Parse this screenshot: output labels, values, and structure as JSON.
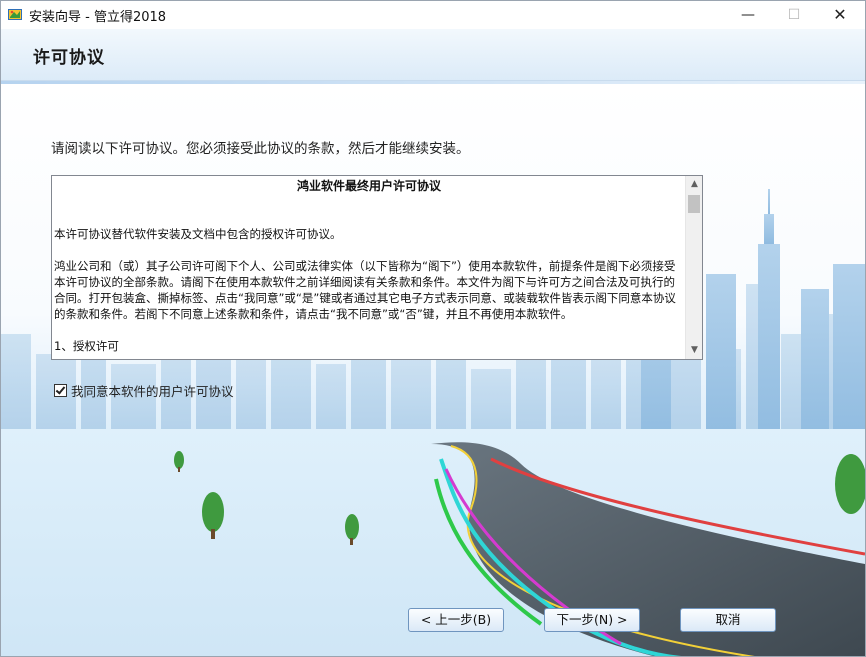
{
  "window": {
    "title": "安装向导 - 管立得2018",
    "app_icon": "installer-icon",
    "controls": {
      "minimize": "—",
      "maximize": "☐",
      "close": "✕"
    }
  },
  "header": {
    "title": "许可协议"
  },
  "instruction": "请阅读以下许可协议。您必须接受此协议的条款，然后才能继续安装。",
  "license": {
    "title": "鸿业软件最终用户许可协议",
    "paragraphs": [
      "本许可协议替代软件安装及文档中包含的授权许可协议。",
      "鸿业公司和（或）其子公司许可阁下个人、公司或法律实体（以下皆称为“阁下”）使用本款软件，前提条件是阁下必须接受本许可协议的全部条款。请阁下在使用本款软件之前详细阅读有关条款和条件。本文件为阁下与许可方之间合法及可执行的合同。打开包装盒、撕掉标签、点击“我同意”或“是”键或者通过其它电子方式表示同意、或装载软件皆表示阁下同意本协议的条款和条件。若阁下不同意上述条款和条件，请点击“我不同意”或“否”键，并且不再使用本款软件。",
      "1、授权许可"
    ],
    "scroll_up": "▲",
    "scroll_down": "▼"
  },
  "agree": {
    "checked": true,
    "label": "我同意本软件的用户许可协议"
  },
  "buttons": {
    "back": "< 上一步(B)",
    "next": "下一步(N) >",
    "cancel": "取消"
  }
}
